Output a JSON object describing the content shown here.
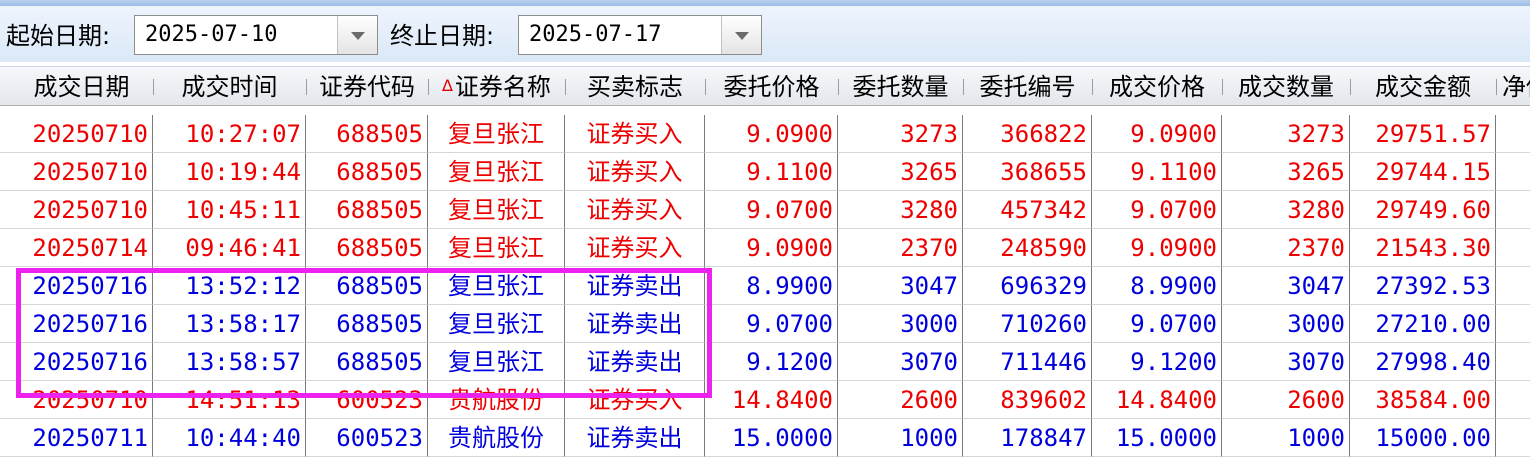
{
  "toolbar": {
    "start_label": "起始日期:",
    "start_value": "2025-07-10",
    "end_label": "终止日期:",
    "end_value": "2025-07-17"
  },
  "columns": [
    {
      "label": "成交日期"
    },
    {
      "label": "成交时间"
    },
    {
      "label": "证券代码"
    },
    {
      "label": "证券名称",
      "sorted": true
    },
    {
      "label": "买卖标志"
    },
    {
      "label": "委托价格"
    },
    {
      "label": "委托数量"
    },
    {
      "label": "委托编号"
    },
    {
      "label": "成交价格"
    },
    {
      "label": "成交数量"
    },
    {
      "label": "成交金额"
    },
    {
      "label": "净佣"
    }
  ],
  "sort_indicator": "∆",
  "rows": [
    {
      "side": "buy",
      "cells": [
        "20250710",
        "10:27:07",
        "688505",
        "复旦张江",
        "证券买入",
        "9.0900",
        "3273",
        "366822",
        "9.0900",
        "3273",
        "29751.57",
        ""
      ]
    },
    {
      "side": "buy",
      "cells": [
        "20250710",
        "10:19:44",
        "688505",
        "复旦张江",
        "证券买入",
        "9.1100",
        "3265",
        "368655",
        "9.1100",
        "3265",
        "29744.15",
        ""
      ]
    },
    {
      "side": "buy",
      "cells": [
        "20250710",
        "10:45:11",
        "688505",
        "复旦张江",
        "证券买入",
        "9.0700",
        "3280",
        "457342",
        "9.0700",
        "3280",
        "29749.60",
        ""
      ]
    },
    {
      "side": "buy",
      "cells": [
        "20250714",
        "09:46:41",
        "688505",
        "复旦张江",
        "证券买入",
        "9.0900",
        "2370",
        "248590",
        "9.0900",
        "2370",
        "21543.30",
        ""
      ]
    },
    {
      "side": "sell",
      "cells": [
        "20250716",
        "13:52:12",
        "688505",
        "复旦张江",
        "证券卖出",
        "8.9900",
        "3047",
        "696329",
        "8.9900",
        "3047",
        "27392.53",
        ""
      ]
    },
    {
      "side": "sell",
      "cells": [
        "20250716",
        "13:58:17",
        "688505",
        "复旦张江",
        "证券卖出",
        "9.0700",
        "3000",
        "710260",
        "9.0700",
        "3000",
        "27210.00",
        ""
      ]
    },
    {
      "side": "sell",
      "cells": [
        "20250716",
        "13:58:57",
        "688505",
        "复旦张江",
        "证券卖出",
        "9.1200",
        "3070",
        "711446",
        "9.1200",
        "3070",
        "27998.40",
        ""
      ]
    },
    {
      "side": "buy",
      "cells": [
        "20250710",
        "14:51:13",
        "600523",
        "贵航股份",
        "证券买入",
        "14.8400",
        "2600",
        "839602",
        "14.8400",
        "2600",
        "38584.00",
        ""
      ]
    },
    {
      "side": "sell",
      "cells": [
        "20250711",
        "10:44:40",
        "600523",
        "贵航股份",
        "证券卖出",
        "15.0000",
        "1000",
        "178847",
        "15.0000",
        "1000",
        "15000.00",
        ""
      ]
    }
  ],
  "colors": {
    "buy": "#ee0000",
    "sell": "#0000dd",
    "highlight": "#ee22ee"
  }
}
